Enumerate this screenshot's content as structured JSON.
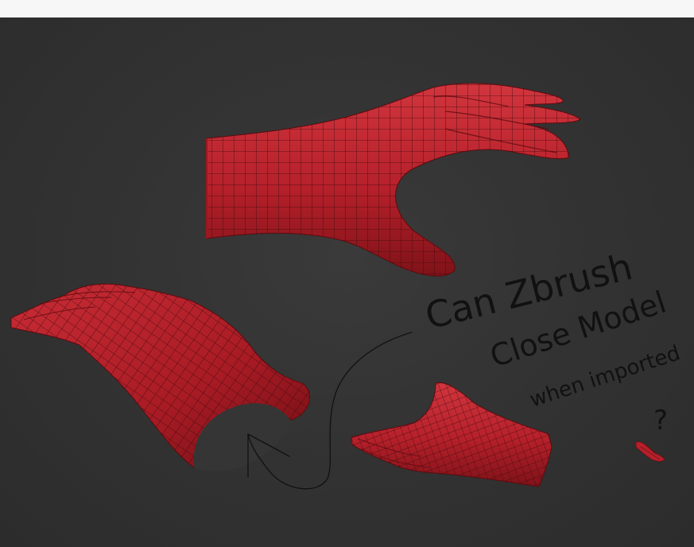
{
  "annotation": {
    "line1": "Can Zbrush",
    "line2": "Close Model",
    "line3": "when imported",
    "line4": "?"
  },
  "colors": {
    "background": "#2f2f2f",
    "top_strip": "#f7f7f7",
    "mesh_red": "#b5202a",
    "mesh_dark": "#7f1218",
    "wireframe": "#3d0a0d",
    "ink": "#111111"
  },
  "icons": {
    "mini_hand": "hand-mini-icon"
  }
}
